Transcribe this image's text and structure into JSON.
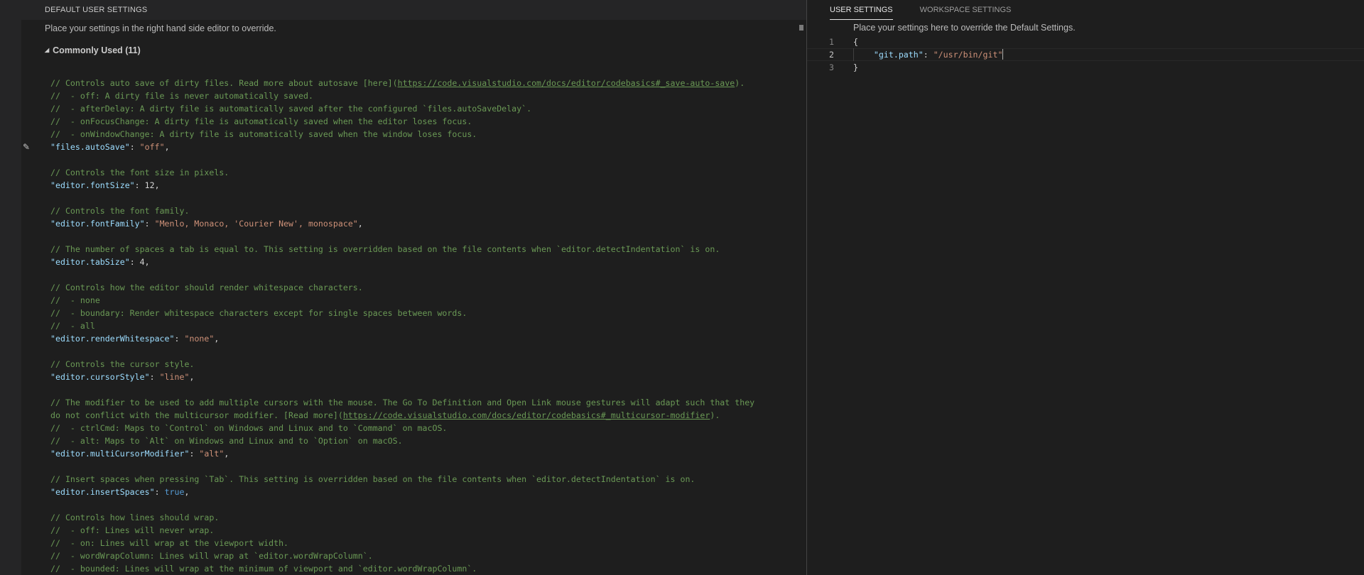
{
  "left_pane": {
    "header": "DEFAULT USER SETTINGS",
    "hint": "Place your settings in the right hand side editor to override.",
    "group_label": "Commonly Used (11)",
    "lines": [
      {
        "t": "c",
        "v": "// Controls auto save of dirty files. Read more about autosave [here](",
        "link": "https://code.visualstudio.com/docs/editor/codebasics#_save-auto-save",
        "after": ")."
      },
      {
        "t": "c",
        "v": "//  - off: A dirty file is never automatically saved."
      },
      {
        "t": "c",
        "v": "//  - afterDelay: A dirty file is automatically saved after the configured `files.autoSaveDelay`."
      },
      {
        "t": "c",
        "v": "//  - onFocusChange: A dirty file is automatically saved when the editor loses focus."
      },
      {
        "t": "c",
        "v": "//  - onWindowChange: A dirty file is automatically saved when the window loses focus."
      },
      {
        "t": "kv",
        "key": "\"files.autoSave\"",
        "val": "\"off\"",
        "vt": "s"
      },
      {
        "t": "blank"
      },
      {
        "t": "c",
        "v": "// Controls the font size in pixels."
      },
      {
        "t": "kv",
        "key": "\"editor.fontSize\"",
        "val": "12",
        "vt": "p"
      },
      {
        "t": "blank"
      },
      {
        "t": "c",
        "v": "// Controls the font family."
      },
      {
        "t": "kv",
        "key": "\"editor.fontFamily\"",
        "val": "\"Menlo, Monaco, 'Courier New', monospace\"",
        "vt": "s"
      },
      {
        "t": "blank"
      },
      {
        "t": "c",
        "v": "// The number of spaces a tab is equal to. This setting is overridden based on the file contents when `editor.detectIndentation` is on."
      },
      {
        "t": "kv",
        "key": "\"editor.tabSize\"",
        "val": "4",
        "vt": "p"
      },
      {
        "t": "blank"
      },
      {
        "t": "c",
        "v": "// Controls how the editor should render whitespace characters."
      },
      {
        "t": "c",
        "v": "//  - none"
      },
      {
        "t": "c",
        "v": "//  - boundary: Render whitespace characters except for single spaces between words."
      },
      {
        "t": "c",
        "v": "//  - all"
      },
      {
        "t": "kv",
        "key": "\"editor.renderWhitespace\"",
        "val": "\"none\"",
        "vt": "s"
      },
      {
        "t": "blank"
      },
      {
        "t": "c",
        "v": "// Controls the cursor style."
      },
      {
        "t": "kv",
        "key": "\"editor.cursorStyle\"",
        "val": "\"line\"",
        "vt": "s"
      },
      {
        "t": "blank"
      },
      {
        "t": "c",
        "v": "// The modifier to be used to add multiple cursors with the mouse. The Go To Definition and Open Link mouse gestures will adapt such that they"
      },
      {
        "t": "c",
        "v": "do not conflict with the multicursor modifier. [Read more](",
        "link": "https://code.visualstudio.com/docs/editor/codebasics#_multicursor-modifier",
        "after": ")."
      },
      {
        "t": "c",
        "v": "//  - ctrlCmd: Maps to `Control` on Windows and Linux and to `Command` on macOS."
      },
      {
        "t": "c",
        "v": "//  - alt: Maps to `Alt` on Windows and Linux and to `Option` on macOS."
      },
      {
        "t": "kv",
        "key": "\"editor.multiCursorModifier\"",
        "val": "\"alt\"",
        "vt": "s"
      },
      {
        "t": "blank"
      },
      {
        "t": "c",
        "v": "// Insert spaces when pressing `Tab`. This setting is overridden based on the file contents when `editor.detectIndentation` is on."
      },
      {
        "t": "kv",
        "key": "\"editor.insertSpaces\"",
        "val": "true",
        "vt": "b"
      },
      {
        "t": "blank"
      },
      {
        "t": "c",
        "v": "// Controls how lines should wrap."
      },
      {
        "t": "c",
        "v": "//  - off: Lines will never wrap."
      },
      {
        "t": "c",
        "v": "//  - on: Lines will wrap at the viewport width."
      },
      {
        "t": "c",
        "v": "//  - wordWrapColumn: Lines will wrap at `editor.wordWrapColumn`."
      },
      {
        "t": "c",
        "v": "//  - bounded: Lines will wrap at the minimum of viewport and `editor.wordWrapColumn`."
      }
    ]
  },
  "right_pane": {
    "tabs": [
      {
        "label": "USER SETTINGS",
        "active": true
      },
      {
        "label": "WORKSPACE SETTINGS",
        "active": false
      }
    ],
    "hint": "Place your settings here to override the Default Settings.",
    "lines": [
      {
        "num": "1",
        "text": "{"
      },
      {
        "num": "2",
        "key": "\"git.path\"",
        "val": "\"/usr/bin/git\""
      },
      {
        "num": "3",
        "text": "}"
      }
    ]
  },
  "colors": {
    "comment": "#6a9955",
    "key": "#9cdcfe",
    "string": "#ce9178",
    "keyword": "#569cd6",
    "background": "#1e1e1e"
  }
}
